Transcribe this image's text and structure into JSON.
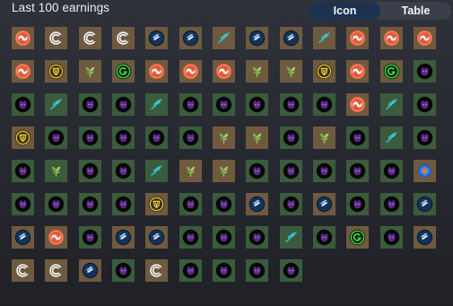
{
  "title": "Last 100 earnings",
  "view_toggle": {
    "options": [
      "Icon",
      "Table"
    ],
    "selected": "Icon"
  },
  "colors": {
    "tile_tan": "#6e5a3f",
    "tile_green": "#3b5b3d",
    "toggle_active": "#1b3350",
    "toggle_bg": "#3a3f49"
  },
  "earnings": [
    {
      "icon": "orange-swirl-coin",
      "tile": "tan"
    },
    {
      "icon": "white-c-coin",
      "tile": "tan"
    },
    {
      "icon": "white-c-coin",
      "tile": "tan"
    },
    {
      "icon": "white-c-coin",
      "tile": "tan"
    },
    {
      "icon": "blue-stack-coin",
      "tile": "tan"
    },
    {
      "icon": "blue-stack-coin",
      "tile": "tan"
    },
    {
      "icon": "teal-chain-icon",
      "tile": "tan"
    },
    {
      "icon": "blue-stack-coin",
      "tile": "tan"
    },
    {
      "icon": "blue-stack-coin",
      "tile": "tan"
    },
    {
      "icon": "teal-chain-icon",
      "tile": "tan"
    },
    {
      "icon": "orange-swirl-coin",
      "tile": "tan"
    },
    {
      "icon": "orange-swirl-coin",
      "tile": "tan"
    },
    {
      "icon": "orange-swirl-coin",
      "tile": "tan"
    },
    {
      "icon": "orange-swirl-coin",
      "tile": "tan"
    },
    {
      "icon": "yellow-shield-coin",
      "tile": "tan"
    },
    {
      "icon": "green-plant-icon",
      "tile": "tan"
    },
    {
      "icon": "green-g-coin",
      "tile": "tan"
    },
    {
      "icon": "orange-swirl-coin",
      "tile": "tan"
    },
    {
      "icon": "orange-swirl-coin",
      "tile": "tan"
    },
    {
      "icon": "orange-swirl-coin",
      "tile": "tan"
    },
    {
      "icon": "green-plant-icon",
      "tile": "tan"
    },
    {
      "icon": "green-plant-icon",
      "tile": "tan"
    },
    {
      "icon": "yellow-shield-coin",
      "tile": "tan"
    },
    {
      "icon": "orange-swirl-coin",
      "tile": "tan"
    },
    {
      "icon": "green-g-coin",
      "tile": "tan"
    },
    {
      "icon": "purple-cat-coin",
      "tile": "green"
    },
    {
      "icon": "purple-cat-coin",
      "tile": "green"
    },
    {
      "icon": "teal-chain-icon",
      "tile": "green"
    },
    {
      "icon": "purple-cat-coin",
      "tile": "green"
    },
    {
      "icon": "purple-cat-coin",
      "tile": "green"
    },
    {
      "icon": "teal-chain-icon",
      "tile": "green"
    },
    {
      "icon": "purple-cat-coin",
      "tile": "green"
    },
    {
      "icon": "purple-cat-coin",
      "tile": "green"
    },
    {
      "icon": "purple-cat-coin",
      "tile": "green"
    },
    {
      "icon": "purple-cat-coin",
      "tile": "green"
    },
    {
      "icon": "purple-cat-coin",
      "tile": "green"
    },
    {
      "icon": "orange-swirl-coin",
      "tile": "tan"
    },
    {
      "icon": "teal-chain-icon",
      "tile": "green"
    },
    {
      "icon": "purple-cat-coin",
      "tile": "green"
    },
    {
      "icon": "yellow-shield-coin",
      "tile": "tan"
    },
    {
      "icon": "purple-cat-coin",
      "tile": "green"
    },
    {
      "icon": "purple-cat-coin",
      "tile": "green"
    },
    {
      "icon": "purple-cat-coin",
      "tile": "green"
    },
    {
      "icon": "purple-cat-coin",
      "tile": "green"
    },
    {
      "icon": "purple-cat-coin",
      "tile": "green"
    },
    {
      "icon": "green-plant-icon",
      "tile": "tan"
    },
    {
      "icon": "green-plant-icon",
      "tile": "tan"
    },
    {
      "icon": "purple-cat-coin",
      "tile": "green"
    },
    {
      "icon": "green-plant-icon",
      "tile": "tan"
    },
    {
      "icon": "purple-cat-coin",
      "tile": "green"
    },
    {
      "icon": "teal-chain-icon",
      "tile": "green"
    },
    {
      "icon": "purple-cat-coin",
      "tile": "green"
    },
    {
      "icon": "purple-cat-coin",
      "tile": "green"
    },
    {
      "icon": "green-plant-icon",
      "tile": "green"
    },
    {
      "icon": "purple-cat-coin",
      "tile": "green"
    },
    {
      "icon": "purple-cat-coin",
      "tile": "green"
    },
    {
      "icon": "teal-chain-icon",
      "tile": "green"
    },
    {
      "icon": "green-plant-icon",
      "tile": "tan"
    },
    {
      "icon": "green-plant-icon",
      "tile": "tan"
    },
    {
      "icon": "purple-cat-coin",
      "tile": "green"
    },
    {
      "icon": "purple-cat-coin",
      "tile": "green"
    },
    {
      "icon": "purple-cat-coin",
      "tile": "green"
    },
    {
      "icon": "purple-cat-coin",
      "tile": "green"
    },
    {
      "icon": "purple-cat-coin",
      "tile": "green"
    },
    {
      "icon": "rare-blue-gem-icon",
      "tile": "rare"
    },
    {
      "icon": "purple-cat-coin",
      "tile": "green"
    },
    {
      "icon": "purple-cat-coin",
      "tile": "green"
    },
    {
      "icon": "purple-cat-coin",
      "tile": "green"
    },
    {
      "icon": "purple-cat-coin",
      "tile": "green"
    },
    {
      "icon": "yellow-shield-coin",
      "tile": "tan"
    },
    {
      "icon": "purple-cat-coin",
      "tile": "green"
    },
    {
      "icon": "purple-cat-coin",
      "tile": "green"
    },
    {
      "icon": "blue-stack-coin",
      "tile": "tan"
    },
    {
      "icon": "purple-cat-coin",
      "tile": "green"
    },
    {
      "icon": "blue-stack-coin",
      "tile": "tan"
    },
    {
      "icon": "purple-cat-coin",
      "tile": "green"
    },
    {
      "icon": "purple-cat-coin",
      "tile": "green"
    },
    {
      "icon": "blue-stack-coin",
      "tile": "green"
    },
    {
      "icon": "blue-stack-coin",
      "tile": "tan"
    },
    {
      "icon": "orange-swirl-coin",
      "tile": "tan"
    },
    {
      "icon": "purple-cat-coin",
      "tile": "green"
    },
    {
      "icon": "blue-stack-coin",
      "tile": "tan"
    },
    {
      "icon": "blue-stack-coin",
      "tile": "tan"
    },
    {
      "icon": "purple-cat-coin",
      "tile": "green"
    },
    {
      "icon": "purple-cat-coin",
      "tile": "green"
    },
    {
      "icon": "purple-cat-coin",
      "tile": "green"
    },
    {
      "icon": "teal-chain-icon",
      "tile": "green"
    },
    {
      "icon": "purple-cat-coin",
      "tile": "green"
    },
    {
      "icon": "green-g-coin",
      "tile": "tan"
    },
    {
      "icon": "purple-cat-coin",
      "tile": "green"
    },
    {
      "icon": "blue-stack-coin",
      "tile": "tan"
    },
    {
      "icon": "white-c-coin",
      "tile": "tan"
    },
    {
      "icon": "white-c-coin",
      "tile": "tan"
    },
    {
      "icon": "blue-stack-coin",
      "tile": "tan"
    },
    {
      "icon": "purple-cat-coin",
      "tile": "green"
    },
    {
      "icon": "white-c-coin",
      "tile": "tan"
    },
    {
      "icon": "purple-cat-coin",
      "tile": "green"
    },
    {
      "icon": "purple-cat-coin",
      "tile": "green"
    },
    {
      "icon": "purple-cat-coin",
      "tile": "green"
    },
    {
      "icon": "purple-cat-coin",
      "tile": "green"
    }
  ]
}
